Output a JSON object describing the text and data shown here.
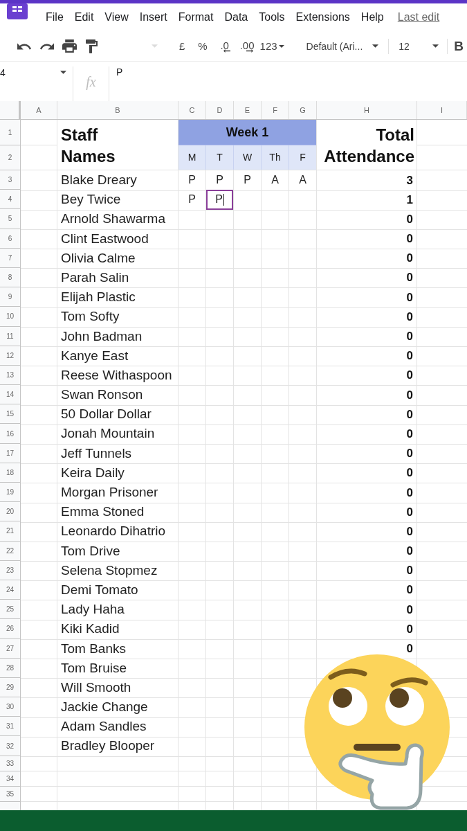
{
  "menu_bar": {
    "items": [
      "File",
      "Edit",
      "View",
      "Insert",
      "Format",
      "Data",
      "Tools",
      "Extensions",
      "Help"
    ],
    "last_edit": "Last edit"
  },
  "toolbar": {
    "currency": "£",
    "percent": "%",
    "decrease_decimal": ".0",
    "increase_decimal": ".00",
    "number_format": "123",
    "font": "Default (Ari...",
    "font_size": "12",
    "bold": "B"
  },
  "formula_bar": {
    "cell_ref": "4",
    "fx": "fx",
    "value": "P"
  },
  "sheet": {
    "columns": [
      "A",
      "B",
      "C",
      "D",
      "E",
      "F",
      "G",
      "H",
      "I"
    ],
    "header": {
      "row_numbers": [
        "1",
        "2"
      ],
      "staff_names": "Staff Names",
      "week": "Week 1",
      "days": [
        "M",
        "T",
        "W",
        "Th",
        "F"
      ],
      "total": "Total Attendance"
    },
    "rows": [
      {
        "number": "3",
        "name": "Blake Dreary",
        "cells": [
          {
            "value": "P",
            "selected": false
          },
          {
            "value": "P",
            "selected": false
          },
          {
            "value": "P",
            "selected": false
          },
          {
            "value": "A",
            "selected": false
          },
          {
            "value": "A",
            "selected": false
          }
        ],
        "total": "3"
      },
      {
        "number": "4",
        "name": "Bey Twice",
        "cells": [
          {
            "value": "P",
            "selected": false
          },
          {
            "value": "P",
            "selected": true
          }
        ],
        "total": "1"
      },
      {
        "number": "5",
        "name": "Arnold Shawarma",
        "total": "0"
      },
      {
        "number": "6",
        "name": "Clint Eastwood",
        "total": "0"
      },
      {
        "number": "7",
        "name": "Olivia Calme",
        "total": "0"
      },
      {
        "number": "8",
        "name": "Parah Salin",
        "total": "0"
      },
      {
        "number": "9",
        "name": "Elijah Plastic",
        "total": "0"
      },
      {
        "number": "10",
        "name": "Tom Softy",
        "total": "0"
      },
      {
        "number": "11",
        "name": "John Badman",
        "total": "0"
      },
      {
        "number": "12",
        "name": "Kanye East",
        "total": "0"
      },
      {
        "number": "13",
        "name": "Reese Withaspoon",
        "total": "0"
      },
      {
        "number": "14",
        "name": "Swan Ronson",
        "total": "0"
      },
      {
        "number": "15",
        "name": "50 Dollar Dollar",
        "total": "0"
      },
      {
        "number": "16",
        "name": "Jonah Mountain",
        "total": "0"
      },
      {
        "number": "17",
        "name": "Jeff Tunnels",
        "total": "0"
      },
      {
        "number": "18",
        "name": "Keira Daily",
        "total": "0"
      },
      {
        "number": "19",
        "name": "Morgan Prisoner",
        "total": "0"
      },
      {
        "number": "20",
        "name": "Emma Stoned",
        "total": "0"
      },
      {
        "number": "21",
        "name": "Leonardo Dihatrio",
        "total": "0"
      },
      {
        "number": "22",
        "name": "Tom Drive",
        "total": "0"
      },
      {
        "number": "23",
        "name": "Selena Stopmez",
        "total": "0"
      },
      {
        "number": "24",
        "name": "Demi Tomato",
        "total": "0"
      },
      {
        "number": "25",
        "name": "Lady Haha",
        "total": "0"
      },
      {
        "number": "26",
        "name": "Kiki Kadid",
        "total": "0"
      },
      {
        "number": "27",
        "name": "Tom Banks",
        "total": "0"
      },
      {
        "number": "28",
        "name": "Tom Bruise"
      },
      {
        "number": "29",
        "name": "Will Smooth"
      },
      {
        "number": "30",
        "name": "Jackie Change"
      },
      {
        "number": "31",
        "name": "Adam Sandles"
      },
      {
        "number": "32",
        "name": "Bradley Blooper"
      }
    ],
    "empty_rows": [
      "33",
      "34",
      "35"
    ]
  }
}
